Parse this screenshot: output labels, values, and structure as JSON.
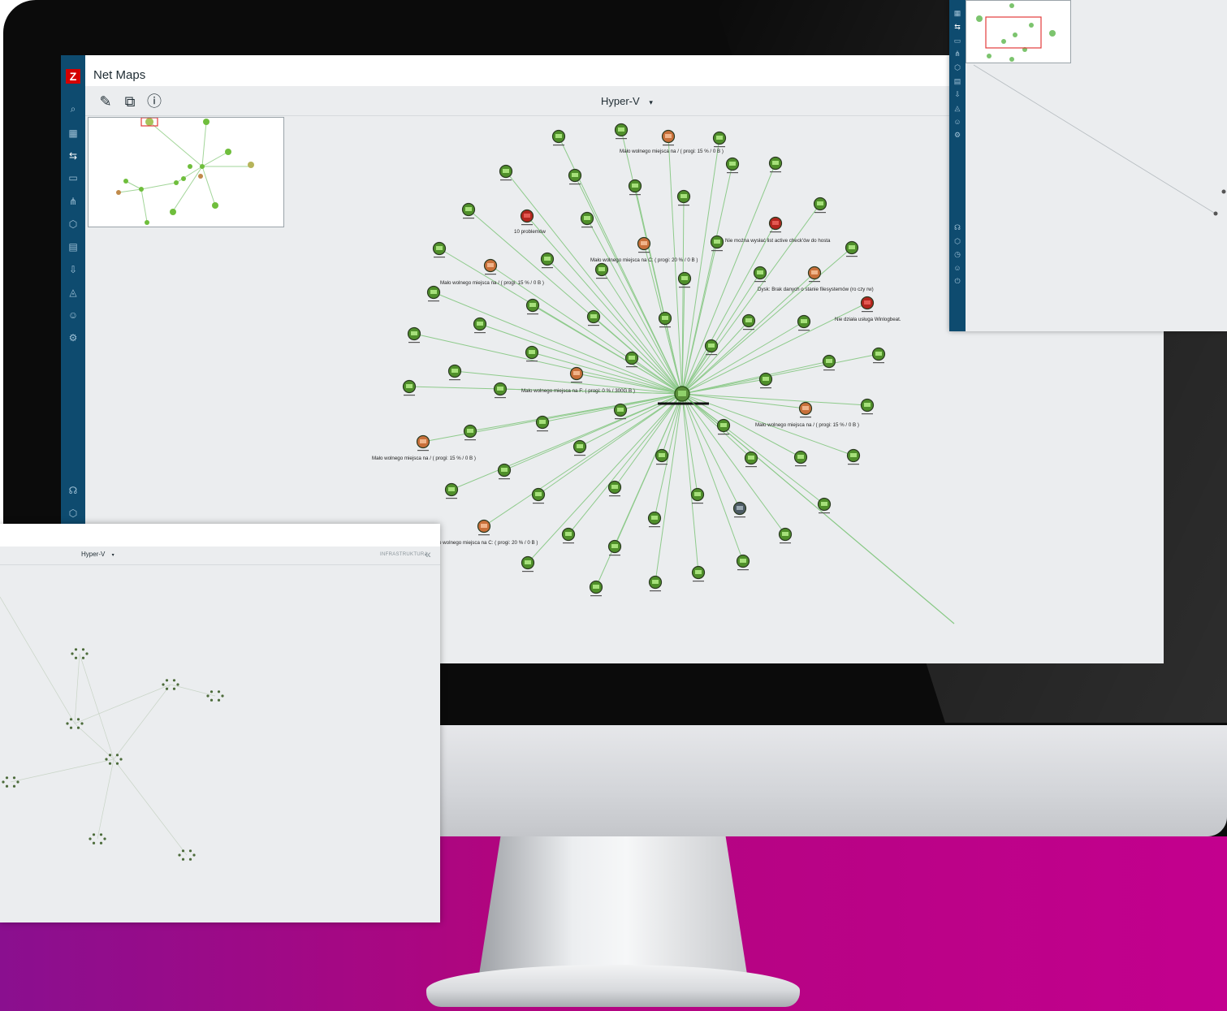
{
  "app": {
    "logo_letter": "Z",
    "title": "Net Maps"
  },
  "toolbar": {
    "edit_icon": "pencil-icon",
    "export_icon": "external-link-icon",
    "help_icon": "help-icon",
    "map_selected": "Hyper-V",
    "dropdown_glyph": "▾"
  },
  "sidebar": {
    "items": [
      {
        "icon": "search-icon"
      },
      {
        "icon": "dashboard-icon"
      },
      {
        "icon": "network-icon"
      },
      {
        "icon": "monitoring-icon"
      },
      {
        "icon": "topology-icon"
      },
      {
        "icon": "inventory-icon"
      },
      {
        "icon": "reports-icon"
      },
      {
        "icon": "import-icon"
      },
      {
        "icon": "alerts-icon"
      },
      {
        "icon": "users-icon"
      },
      {
        "icon": "settings-icon"
      },
      {
        "icon": "support-icon"
      },
      {
        "icon": "integrations-icon"
      }
    ]
  },
  "problems": {
    "p1": "Mało wolnego miejsca na / ( progi: 15 % / 0 B )",
    "p2": "10 problemów",
    "p3": "Mało wolnego miejsca na C: ( progi: 20 % / 0 B )",
    "p4": "Nie można wysłać list active check'ów do hosta",
    "p5": "Mało wolnego miejsca na / ( progi: 15 % / 0 B )",
    "p6": "Dysk: Brak danych o stanie filesystemów (ro czy rw)",
    "p7": "Nie działa usługa Winlogbeat.",
    "p8": "Mało wolnego miejsca na F: ( progi: 0 % / 300G B )",
    "p9": "Mało wolnego miejsca na / ( progi: 15 % / 0 B )",
    "p10": "Mało wolnego miejsca na / ( progi: 15 % / 0 B )",
    "p11": "o wolnego miejsca na C: ( progi: 20 % / 0 B )"
  },
  "bottom_window": {
    "map_selected": "Hyper-V",
    "dropdown_glyph": "▾",
    "section_label": "INFRASTRUKTURA",
    "collapse_glyph": "«"
  },
  "colors": {
    "sidebar": "#0e4b6f",
    "node_ok": "#4f8f2a",
    "node_warning": "#c8703a",
    "node_disaster": "#b3261e",
    "node_unknown": "#4c5a63",
    "link": "#6fbf6a",
    "brand_magenta": "#c3008e"
  }
}
